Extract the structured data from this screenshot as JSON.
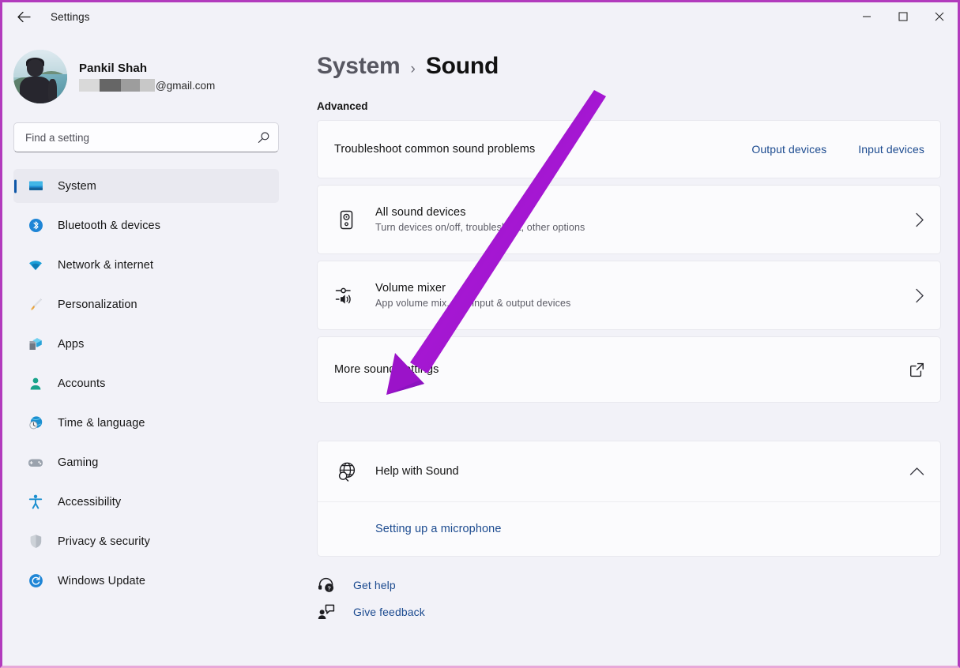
{
  "titlebar": {
    "back_icon": "back-arrow-icon",
    "title": "Settings",
    "minimize_label": "–",
    "maximize_label": "□",
    "close_label": "✕"
  },
  "account": {
    "name": "Pankil Shah",
    "email_redacted": true,
    "email_domain": "@gmail.com"
  },
  "search": {
    "placeholder": "Find a setting",
    "value": "",
    "icon": "search-icon"
  },
  "sidebar": {
    "items": [
      {
        "label": "System",
        "icon": "monitor-icon",
        "selected": true
      },
      {
        "label": "Bluetooth & devices",
        "icon": "bluetooth-icon",
        "selected": false
      },
      {
        "label": "Network & internet",
        "icon": "wifi-icon",
        "selected": false
      },
      {
        "label": "Personalization",
        "icon": "paintbrush-icon",
        "selected": false
      },
      {
        "label": "Apps",
        "icon": "apps-icon",
        "selected": false
      },
      {
        "label": "Accounts",
        "icon": "person-icon",
        "selected": false
      },
      {
        "label": "Time & language",
        "icon": "clock-globe-icon",
        "selected": false
      },
      {
        "label": "Gaming",
        "icon": "gamepad-icon",
        "selected": false
      },
      {
        "label": "Accessibility",
        "icon": "accessibility-icon",
        "selected": false
      },
      {
        "label": "Privacy & security",
        "icon": "shield-icon",
        "selected": false
      },
      {
        "label": "Windows Update",
        "icon": "update-icon",
        "selected": false
      }
    ]
  },
  "breadcrumb": {
    "parent": "System",
    "separator": "›",
    "current": "Sound"
  },
  "main": {
    "section_label": "Advanced",
    "cards": [
      {
        "title": "Troubleshoot common sound problems",
        "sub": "",
        "icon": "",
        "links": [
          "Output devices",
          "Input devices"
        ],
        "trailing": ""
      },
      {
        "title": "All sound devices",
        "sub": "Turn devices on/off, troubleshoot, other options",
        "icon": "speaker-icon",
        "links": [],
        "trailing": "chevron-right-icon"
      },
      {
        "title": "Volume mixer",
        "sub": "App volume mix, app input & output devices",
        "icon": "volume-mixer-icon",
        "links": [],
        "trailing": "chevron-right-icon"
      },
      {
        "title": "More sound settings",
        "sub": "",
        "icon": "",
        "links": [],
        "trailing": "external-link-icon"
      }
    ],
    "help": {
      "title": "Help with Sound",
      "icon": "globe-search-icon",
      "expand_icon": "chevron-up-icon",
      "items": [
        "Setting up a microphone"
      ]
    },
    "footer": [
      {
        "label": "Get help",
        "icon": "help-headset-icon"
      },
      {
        "label": "Give feedback",
        "icon": "feedback-icon"
      }
    ]
  },
  "annotation": {
    "type": "arrow",
    "color": "#9B13C9",
    "points_to": "More sound settings"
  },
  "colors": {
    "accent": "#0f57a8",
    "link": "#1b4a8f",
    "page_background": "#f2f2f8",
    "card_background": "#fbfbfd",
    "frame_border": "#b23bbd",
    "annotation_purple": "#9B13C9"
  }
}
